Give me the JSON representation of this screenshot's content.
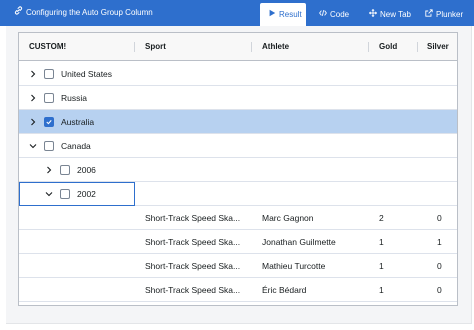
{
  "topbar": {
    "title": "Configuring the Auto Group Column",
    "tabs": [
      {
        "label": "Result",
        "icon": "play-icon"
      },
      {
        "label": "Code",
        "icon": "code-icon"
      },
      {
        "label": "New Tab",
        "icon": "move-icon"
      },
      {
        "label": "Plunker",
        "icon": "external-link-icon"
      }
    ],
    "colors": {
      "bar": "#2e6fcd",
      "active_tab_text": "#2e6fcd"
    }
  },
  "grid": {
    "columns": [
      "CUSTOM!",
      "Sport",
      "Athlete",
      "Gold",
      "Silver"
    ],
    "group_rows": [
      {
        "label": "United States",
        "expanded": false,
        "checked": false,
        "selected": false
      },
      {
        "label": "Russia",
        "expanded": false,
        "checked": false,
        "selected": false
      },
      {
        "label": "Australia",
        "expanded": false,
        "checked": true,
        "selected": true
      },
      {
        "label": "Canada",
        "expanded": true,
        "checked": false,
        "selected": false
      },
      {
        "label": "2006",
        "expanded": false,
        "checked": false,
        "selected": false
      },
      {
        "label": "2002",
        "expanded": true,
        "checked": false,
        "selected": false
      }
    ],
    "leaf_rows": [
      {
        "sport": "Short-Track Speed Ska...",
        "athlete": "Marc Gagnon",
        "gold": "2",
        "silver": "0"
      },
      {
        "sport": "Short-Track Speed Ska...",
        "athlete": "Jonathan Guilmette",
        "gold": "1",
        "silver": "1"
      },
      {
        "sport": "Short-Track Speed Ska...",
        "athlete": "Mathieu Turcotte",
        "gold": "1",
        "silver": "0"
      },
      {
        "sport": "Short-Track Speed Ska...",
        "athlete": "Éric Bédard",
        "gold": "1",
        "silver": "0"
      }
    ],
    "colors": {
      "selected_row": "#b7d1f0",
      "checkbox_checked": "#2e6fcd"
    }
  }
}
